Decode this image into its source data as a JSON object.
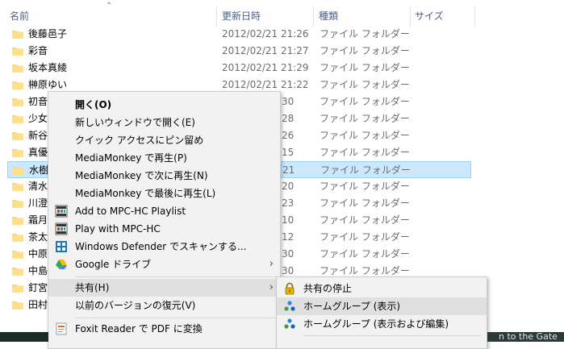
{
  "columns": {
    "name": "名前",
    "date": "更新日時",
    "type": "種類",
    "size": "サイズ"
  },
  "rows": [
    {
      "name": "後藤邑子",
      "date": "2012/02/21 21:26",
      "type": "ファイル フォルダー"
    },
    {
      "name": "彩音",
      "date": "2012/02/21 21:27",
      "type": "ファイル フォルダー"
    },
    {
      "name": "坂本真綾",
      "date": "2012/02/21 21:29",
      "type": "ファイル フォルダー"
    },
    {
      "name": "榊原ゆい",
      "date": "2012/02/21 21:22",
      "type": "ファイル フォルダー"
    },
    {
      "name": "初音",
      "date": "30",
      "type": "ファイル フォルダー"
    },
    {
      "name": "少女",
      "date": "28",
      "type": "ファイル フォルダー"
    },
    {
      "name": "新谷",
      "date": "26",
      "type": "ファイル フォルダー"
    },
    {
      "name": "真優",
      "date": "15",
      "type": "ファイル フォルダー"
    },
    {
      "name": "水樹",
      "date": "21",
      "type": "ファイル フォルダー"
    },
    {
      "name": "清水",
      "date": "20",
      "type": "ファイル フォルダー"
    },
    {
      "name": "川澄",
      "date": "23",
      "type": "ファイル フォルダー"
    },
    {
      "name": "霜月",
      "date": "10",
      "type": "ファイル フォルダー"
    },
    {
      "name": "茶太",
      "date": "12",
      "type": "ファイル フォルダー"
    },
    {
      "name": "中原",
      "date": "30",
      "type": "ファイル フォルダー"
    },
    {
      "name": "中島",
      "date": "30",
      "type": "ファイル フォルダー"
    },
    {
      "name": "釘宮",
      "date": "",
      "type": ""
    },
    {
      "name": "田村",
      "date": "",
      "type": ""
    }
  ],
  "context_menu": {
    "open": "開く(O)",
    "open_new_window": "新しいウィンドウで開く(E)",
    "pin_quick_access": "クイック アクセスにピン留め",
    "mm_play": "MediaMonkey で再生(P)",
    "mm_play_next": "MediaMonkey で次に再生(N)",
    "mm_play_last": "MediaMonkey で最後に再生(L)",
    "mpc_add_playlist": "Add to MPC-HC Playlist",
    "mpc_play": "Play with MPC-HC",
    "defender_scan": "Windows Defender でスキャンする...",
    "google_drive": "Google ドライブ",
    "share": "共有(H)",
    "restore_previous": "以前のバージョンの復元(V)",
    "foxit_pdf": "Foxit Reader で PDF に変換"
  },
  "share_submenu": {
    "stop_sharing": "共有の停止",
    "homegroup_view": "ホームグループ (表示)",
    "homegroup_view_edit": "ホームグループ (表示および編集)"
  },
  "background_text": "n to the Gate",
  "icons": {
    "folder": "folder-icon",
    "mpc": "mpc-hc-icon",
    "defender": "windows-defender-icon",
    "gdrive": "google-drive-icon",
    "foxit": "foxit-icon",
    "lock": "lock-icon",
    "homegroup": "homegroup-icon"
  },
  "colors": {
    "selection_bg": "#cce8ff",
    "selection_border": "#99d1ff",
    "menu_bg": "#f2f2f2",
    "menu_hover": "#e0e0e0",
    "folder_yellow": "#f8d775"
  }
}
